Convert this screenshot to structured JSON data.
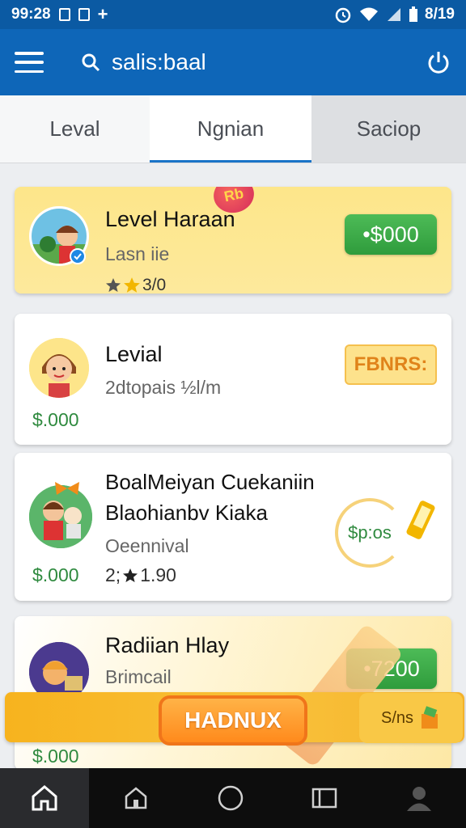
{
  "status_bar": {
    "time": "99:28",
    "right_text": "8/19"
  },
  "app_bar": {
    "search_title": "salis:baal"
  },
  "tabs": [
    {
      "label": "Leval"
    },
    {
      "label": "Ngnian"
    },
    {
      "label": "Saciop"
    }
  ],
  "cards": [
    {
      "title": "Level Haraan",
      "subtitle": "Lasn iie",
      "rating": "3/0",
      "badge": "Rb",
      "button": "•$000"
    },
    {
      "title": "Levial",
      "subtitle": "2dtopais ½l/m",
      "price": "$.000",
      "button": "FBNRS:"
    },
    {
      "title_line1": "BoalMeiyan Cuekaniin",
      "title_line2": "Blaohianbv Kiaka",
      "subtitle": "Oeennival",
      "price": "$.000",
      "meta": "2;",
      "rating": "1.90",
      "circle_text": "$p:os"
    },
    {
      "title": "Radiian Hlay",
      "subtitle": "Brimcail",
      "price": "$.000",
      "button": "•7200"
    }
  ],
  "banner": {
    "button": "HADNUX",
    "side_label": "S/ns"
  },
  "colors": {
    "primary": "#0e66b8",
    "status": "#0b5aa3",
    "green": "#2f8a3f",
    "banner": "#f9c13a"
  },
  "icons": [
    "menu-icon",
    "search-icon",
    "power-icon",
    "star-icon",
    "phone-icon",
    "home-icon",
    "house-icon",
    "circle-icon",
    "recent-apps-icon",
    "profile-icon"
  ]
}
